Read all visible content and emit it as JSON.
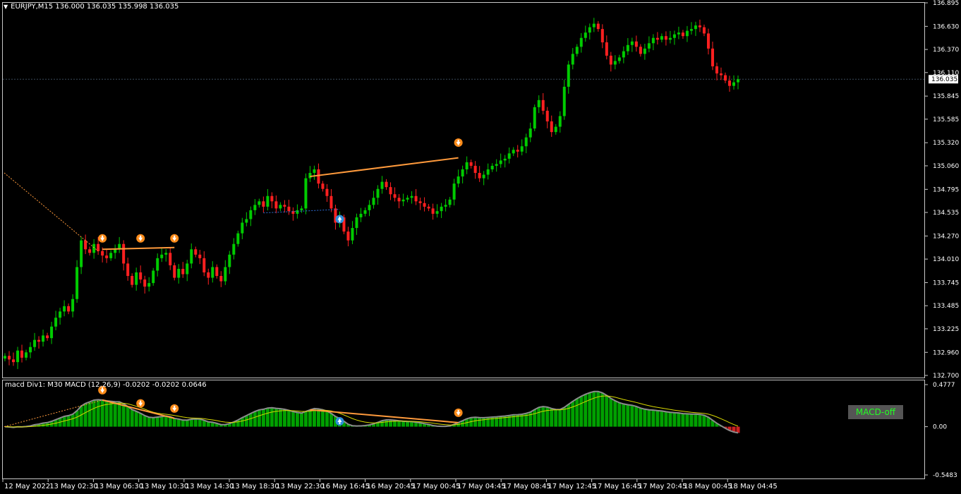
{
  "header": {
    "symbol": "EURJPY,M15",
    "open": "136.000",
    "high": "136.035",
    "low": "135.998",
    "close": "136.035"
  },
  "price_axis": {
    "labels": [
      "136.895",
      "136.630",
      "136.370",
      "136.110",
      "135.845",
      "135.585",
      "135.320",
      "135.060",
      "134.795",
      "134.535",
      "134.270",
      "134.010",
      "133.745",
      "133.485",
      "133.225",
      "132.960",
      "132.700"
    ],
    "current_price": "136.035"
  },
  "time_axis": {
    "labels": [
      "12 May 2022",
      "13 May 02:30",
      "13 May 06:30",
      "13 May 10:30",
      "13 May 14:30",
      "13 May 18:30",
      "13 May 22:30",
      "16 May 16:45",
      "16 May 20:45",
      "17 May 00:45",
      "17 May 04:45",
      "17 May 08:45",
      "17 May 12:45",
      "17 May 16:45",
      "17 May 20:45",
      "18 May 00:45",
      "18 May 04:45"
    ]
  },
  "macd_panel": {
    "title": "macd Div1: M30 MACD (12,26,9) -0.0202 -0.0202 0.0646",
    "axis_labels": [
      "0.4777",
      "0.00",
      "-0.5483"
    ],
    "toggle_label": "MACD-off"
  },
  "colors": {
    "background": "#000000",
    "bull_candle": "#00cc00",
    "bear_candle": "#ff2020",
    "histogram_pos": "#00a000",
    "histogram_neg": "#cc2020",
    "macd_line": "#8c8c8c",
    "signal_line": "#d8d800",
    "divergence_line": "#ff9a3c",
    "bull_arrow": "#2e8fd8",
    "bear_arrow": "#ff8c1a"
  },
  "chart_data": {
    "type": "candlestick",
    "symbol": "EURJPY",
    "timeframe": "M15",
    "ylim": [
      132.7,
      136.895
    ],
    "closes": [
      132.92,
      132.88,
      132.85,
      132.98,
      132.9,
      132.96,
      133.02,
      133.1,
      133.08,
      133.15,
      133.12,
      133.25,
      133.35,
      133.42,
      133.48,
      133.42,
      133.56,
      133.92,
      134.22,
      134.12,
      134.08,
      134.18,
      134.1,
      134.05,
      134.02,
      134.08,
      134.12,
      134.18,
      133.96,
      133.82,
      133.72,
      133.86,
      133.78,
      133.7,
      133.74,
      133.88,
      134.02,
      134.06,
      134.08,
      133.94,
      133.8,
      133.9,
      133.84,
      133.96,
      134.12,
      134.06,
      134.02,
      133.86,
      133.8,
      133.92,
      133.82,
      133.76,
      133.92,
      134.06,
      134.18,
      134.3,
      134.42,
      134.46,
      134.56,
      134.62,
      134.66,
      134.6,
      134.72,
      134.66,
      134.58,
      134.62,
      134.6,
      134.55,
      134.52,
      134.56,
      134.58,
      134.92,
      134.98,
      135.02,
      134.86,
      134.8,
      134.72,
      134.58,
      134.42,
      134.48,
      134.32,
      134.22,
      134.36,
      134.48,
      134.52,
      134.56,
      134.62,
      134.7,
      134.8,
      134.88,
      134.82,
      134.74,
      134.7,
      134.66,
      134.68,
      134.7,
      134.72,
      134.66,
      134.64,
      134.6,
      134.58,
      134.52,
      134.55,
      134.6,
      134.62,
      134.68,
      134.86,
      134.94,
      135.02,
      135.1,
      135.06,
      134.98,
      134.92,
      134.96,
      135.02,
      135.06,
      135.08,
      135.12,
      135.14,
      135.2,
      135.24,
      135.22,
      135.28,
      135.38,
      135.48,
      135.72,
      135.8,
      135.68,
      135.56,
      135.44,
      135.5,
      135.62,
      135.95,
      136.2,
      136.32,
      136.4,
      136.5,
      136.56,
      136.62,
      136.66,
      136.6,
      136.45,
      136.3,
      136.2,
      136.24,
      136.28,
      136.35,
      136.42,
      136.46,
      136.4,
      136.32,
      136.38,
      136.44,
      136.5,
      136.48,
      136.52,
      136.48,
      136.5,
      136.54,
      136.56,
      136.52,
      136.58,
      136.6,
      136.64,
      136.62,
      136.55,
      136.38,
      136.18,
      136.1,
      136.08,
      136.02,
      135.96,
      136.0,
      136.035
    ],
    "annotations": {
      "bearish_divergence_markers": 4,
      "bullish_divergence_markers": 1
    },
    "macd": {
      "title": "M30 MACD (12,26,9)",
      "main": -0.0202,
      "signal": -0.0202,
      "value3": 0.0646,
      "ylim": [
        -0.5483,
        0.4777
      ]
    }
  }
}
